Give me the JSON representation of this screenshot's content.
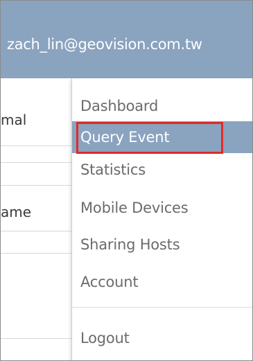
{
  "header": {
    "user_email": "zach_lin@geovision.com.tw"
  },
  "background_page": {
    "field_1_text": "mal",
    "field_2_text": "ame"
  },
  "menu": {
    "items": [
      {
        "label": "Dashboard"
      },
      {
        "label": "Query Event",
        "active": true
      },
      {
        "label": "Statistics"
      },
      {
        "label": "Mobile Devices"
      },
      {
        "label": "Sharing Hosts"
      },
      {
        "label": "Account"
      }
    ],
    "logout_label": "Logout"
  },
  "colors": {
    "topbar": "#8aa3bf",
    "active_item": "#8aa3bf",
    "highlight_outline": "#e12a2a",
    "menu_text": "#6b6b6b"
  }
}
